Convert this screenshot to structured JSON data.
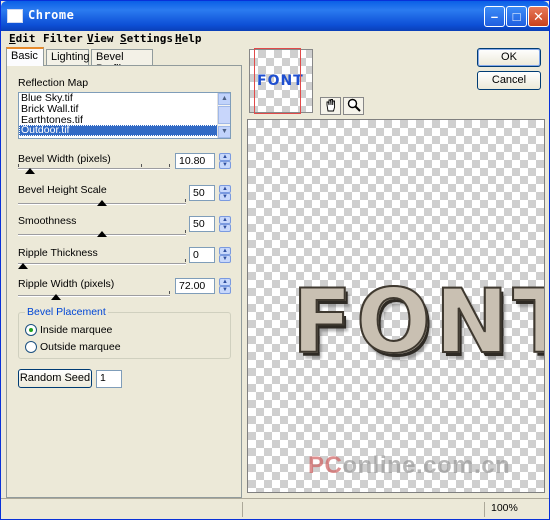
{
  "window": {
    "title": "Chrome"
  },
  "menu": {
    "items": [
      {
        "prefix": "E",
        "rest": "dit"
      },
      {
        "prefix": "",
        "mid": "F",
        "rest": "ilter"
      },
      {
        "prefix": "V",
        "rest": "iew"
      },
      {
        "prefix": "S",
        "rest": "ettings"
      },
      {
        "prefix": "H",
        "rest": "elp"
      }
    ],
    "labels": [
      "Edit",
      "Filter",
      "View",
      "Settings",
      "Help"
    ]
  },
  "tabs": {
    "basic": "Basic",
    "lighting": "Lighting",
    "bevel_profile": "Bevel Profile"
  },
  "reflection_map": {
    "label": "Reflection Map",
    "items": [
      "Blue Sky.tif",
      "Brick Wall.tif",
      "Earthtones.tif",
      "Outdoor.tif"
    ],
    "selected_index": 3
  },
  "controls": {
    "bevel_width": {
      "label": "Bevel Width (pixels)",
      "value": "10.80",
      "position": 0.08
    },
    "bevel_height_scale": {
      "label": "Bevel Height Scale",
      "value": "50",
      "position": 0.5
    },
    "smoothness": {
      "label": "Smoothness",
      "value": "50",
      "position": 0.5
    },
    "ripple_thickness": {
      "label": "Ripple Thickness",
      "value": "0",
      "position": 0.0
    },
    "ripple_width": {
      "label": "Ripple Width (pixels)",
      "value": "72.00",
      "position": 0.25
    }
  },
  "bevel_placement": {
    "title": "Bevel Placement",
    "inside": "Inside marquee",
    "outside": "Outside marquee",
    "selected": "inside"
  },
  "random_seed": {
    "label": "Random Seed",
    "value": "1"
  },
  "buttons": {
    "ok": "OK",
    "cancel": "Cancel"
  },
  "preview": {
    "nav_text": "FONT",
    "art_text": "FONT",
    "watermark_p": "PC",
    "watermark_rest": "online.com.cn"
  },
  "status": {
    "zoom": "100%"
  },
  "colors": {
    "titlebar": "#0a5fe6",
    "selection": "#316ac5",
    "group_title": "#0046d5",
    "nav_rect": "#e04a4a"
  }
}
